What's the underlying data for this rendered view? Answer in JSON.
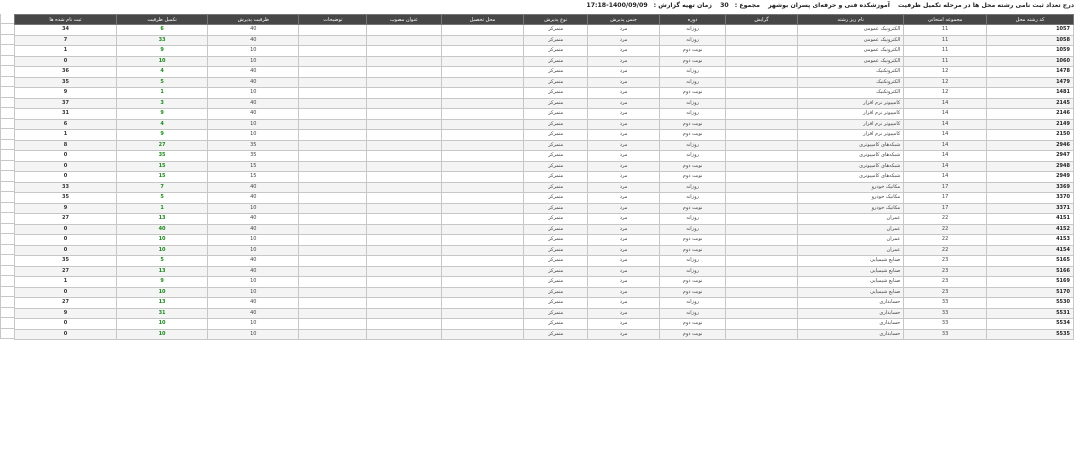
{
  "header": {
    "title": "درج تعداد ثبت نامی رشته محل ها در مرحله تکمیل ظرفیت",
    "school": "آموزشکده فنی و حرفه‌ای پسران بوشهر",
    "total_label": "مجموع :",
    "total_value": "30",
    "time_label": "زمان تهیه گزارش :",
    "time_value": "1400/09/09-17:18"
  },
  "columns": [
    "کد رشته محل",
    "مجموعه امتحانی",
    "نام ریز رشته",
    "گرایش",
    "دوره",
    "جنس پذیرش",
    "نوع پذیرش",
    "محل تحصیل",
    "عنوان مصوب",
    "توضیحات",
    "ظرفیت پذیرش",
    "تکمیل ظرفیت",
    "ثبت نام شده ها"
  ],
  "rows": [
    {
      "code": "1057",
      "group": "11",
      "field": "الکترونیک عمومی",
      "period": "روزانه",
      "gender": "مرد",
      "type": "متمرکز",
      "cap": "40",
      "fill": "6",
      "reg": "34"
    },
    {
      "code": "1058",
      "group": "11",
      "field": "الکترونیک عمومی",
      "period": "روزانه",
      "gender": "مرد",
      "type": "متمرکز",
      "cap": "40",
      "fill": "33",
      "reg": "7"
    },
    {
      "code": "1059",
      "group": "11",
      "field": "الکترونیک عمومی",
      "period": "نوبت دوم",
      "gender": "مرد",
      "type": "متمرکز",
      "cap": "10",
      "fill": "9",
      "reg": "1"
    },
    {
      "code": "1060",
      "group": "11",
      "field": "الکترونیک عمومی",
      "period": "نوبت دوم",
      "gender": "مرد",
      "type": "متمرکز",
      "cap": "10",
      "fill": "10",
      "reg": "0"
    },
    {
      "code": "1478",
      "group": "12",
      "field": "الکتروتکنیک",
      "period": "روزانه",
      "gender": "مرد",
      "type": "متمرکز",
      "cap": "40",
      "fill": "4",
      "reg": "36"
    },
    {
      "code": "1479",
      "group": "12",
      "field": "الکتروتکنیک",
      "period": "روزانه",
      "gender": "مرد",
      "type": "متمرکز",
      "cap": "40",
      "fill": "5",
      "reg": "35"
    },
    {
      "code": "1481",
      "group": "12",
      "field": "الکتروتکنیک",
      "period": "نوبت دوم",
      "gender": "مرد",
      "type": "متمرکز",
      "cap": "10",
      "fill": "1",
      "reg": "9"
    },
    {
      "code": "2145",
      "group": "14",
      "field": "کامپیوتر نرم افزار",
      "period": "روزانه",
      "gender": "مرد",
      "type": "متمرکز",
      "cap": "40",
      "fill": "3",
      "reg": "37"
    },
    {
      "code": "2146",
      "group": "14",
      "field": "کامپیوتر نرم افزار",
      "period": "روزانه",
      "gender": "مرد",
      "type": "متمرکز",
      "cap": "40",
      "fill": "9",
      "reg": "31"
    },
    {
      "code": "2149",
      "group": "14",
      "field": "کامپیوتر نرم افزار",
      "period": "نوبت دوم",
      "gender": "مرد",
      "type": "متمرکز",
      "cap": "10",
      "fill": "4",
      "reg": "6"
    },
    {
      "code": "2150",
      "group": "14",
      "field": "کامپیوتر نرم افزار",
      "period": "نوبت دوم",
      "gender": "مرد",
      "type": "متمرکز",
      "cap": "10",
      "fill": "9",
      "reg": "1"
    },
    {
      "code": "2946",
      "group": "14",
      "field": "شبکه‌های کامپیوتری",
      "period": "روزانه",
      "gender": "مرد",
      "type": "متمرکز",
      "cap": "35",
      "fill": "27",
      "reg": "8"
    },
    {
      "code": "2947",
      "group": "14",
      "field": "شبکه‌های کامپیوتری",
      "period": "روزانه",
      "gender": "مرد",
      "type": "متمرکز",
      "cap": "35",
      "fill": "35",
      "reg": "0"
    },
    {
      "code": "2948",
      "group": "14",
      "field": "شبکه‌های کامپیوتری",
      "period": "نوبت دوم",
      "gender": "مرد",
      "type": "متمرکز",
      "cap": "15",
      "fill": "15",
      "reg": "0"
    },
    {
      "code": "2949",
      "group": "14",
      "field": "شبکه‌های کامپیوتری",
      "period": "نوبت دوم",
      "gender": "مرد",
      "type": "متمرکز",
      "cap": "15",
      "fill": "15",
      "reg": "0"
    },
    {
      "code": "3369",
      "group": "17",
      "field": "مکانیک خودرو",
      "period": "روزانه",
      "gender": "مرد",
      "type": "متمرکز",
      "cap": "40",
      "fill": "7",
      "reg": "33"
    },
    {
      "code": "3370",
      "group": "17",
      "field": "مکانیک خودرو",
      "period": "روزانه",
      "gender": "مرد",
      "type": "متمرکز",
      "cap": "40",
      "fill": "5",
      "reg": "35"
    },
    {
      "code": "3371",
      "group": "17",
      "field": "مکانیک خودرو",
      "period": "نوبت دوم",
      "gender": "مرد",
      "type": "متمرکز",
      "cap": "10",
      "fill": "1",
      "reg": "9"
    },
    {
      "code": "4151",
      "group": "22",
      "field": "عمران",
      "period": "روزانه",
      "gender": "مرد",
      "type": "متمرکز",
      "cap": "40",
      "fill": "13",
      "reg": "27"
    },
    {
      "code": "4152",
      "group": "22",
      "field": "عمران",
      "period": "روزانه",
      "gender": "مرد",
      "type": "متمرکز",
      "cap": "40",
      "fill": "40",
      "reg": "0"
    },
    {
      "code": "4153",
      "group": "22",
      "field": "عمران",
      "period": "نوبت دوم",
      "gender": "مرد",
      "type": "متمرکز",
      "cap": "10",
      "fill": "10",
      "reg": "0"
    },
    {
      "code": "4154",
      "group": "22",
      "field": "عمران",
      "period": "نوبت دوم",
      "gender": "مرد",
      "type": "متمرکز",
      "cap": "10",
      "fill": "10",
      "reg": "0"
    },
    {
      "code": "5165",
      "group": "23",
      "field": "صنایع شیمیایی",
      "period": "روزانه",
      "gender": "مرد",
      "type": "متمرکز",
      "cap": "40",
      "fill": "5",
      "reg": "35"
    },
    {
      "code": "5166",
      "group": "23",
      "field": "صنایع شیمیایی",
      "period": "روزانه",
      "gender": "مرد",
      "type": "متمرکز",
      "cap": "40",
      "fill": "13",
      "reg": "27"
    },
    {
      "code": "5169",
      "group": "23",
      "field": "صنایع شیمیایی",
      "period": "نوبت دوم",
      "gender": "مرد",
      "type": "متمرکز",
      "cap": "10",
      "fill": "9",
      "reg": "1"
    },
    {
      "code": "5170",
      "group": "23",
      "field": "صنایع شیمیایی",
      "period": "نوبت دوم",
      "gender": "مرد",
      "type": "متمرکز",
      "cap": "10",
      "fill": "10",
      "reg": "0"
    },
    {
      "code": "5530",
      "group": "33",
      "field": "حسابداری",
      "period": "روزانه",
      "gender": "مرد",
      "type": "متمرکز",
      "cap": "40",
      "fill": "13",
      "reg": "27"
    },
    {
      "code": "5531",
      "group": "33",
      "field": "حسابداری",
      "period": "روزانه",
      "gender": "مرد",
      "type": "متمرکز",
      "cap": "40",
      "fill": "31",
      "reg": "9"
    },
    {
      "code": "5534",
      "group": "33",
      "field": "حسابداری",
      "period": "نوبت دوم",
      "gender": "مرد",
      "type": "متمرکز",
      "cap": "10",
      "fill": "10",
      "reg": "0"
    },
    {
      "code": "5535",
      "group": "33",
      "field": "حسابداری",
      "period": "نوبت دوم",
      "gender": "مرد",
      "type": "متمرکز",
      "cap": "10",
      "fill": "10",
      "reg": "0"
    }
  ]
}
